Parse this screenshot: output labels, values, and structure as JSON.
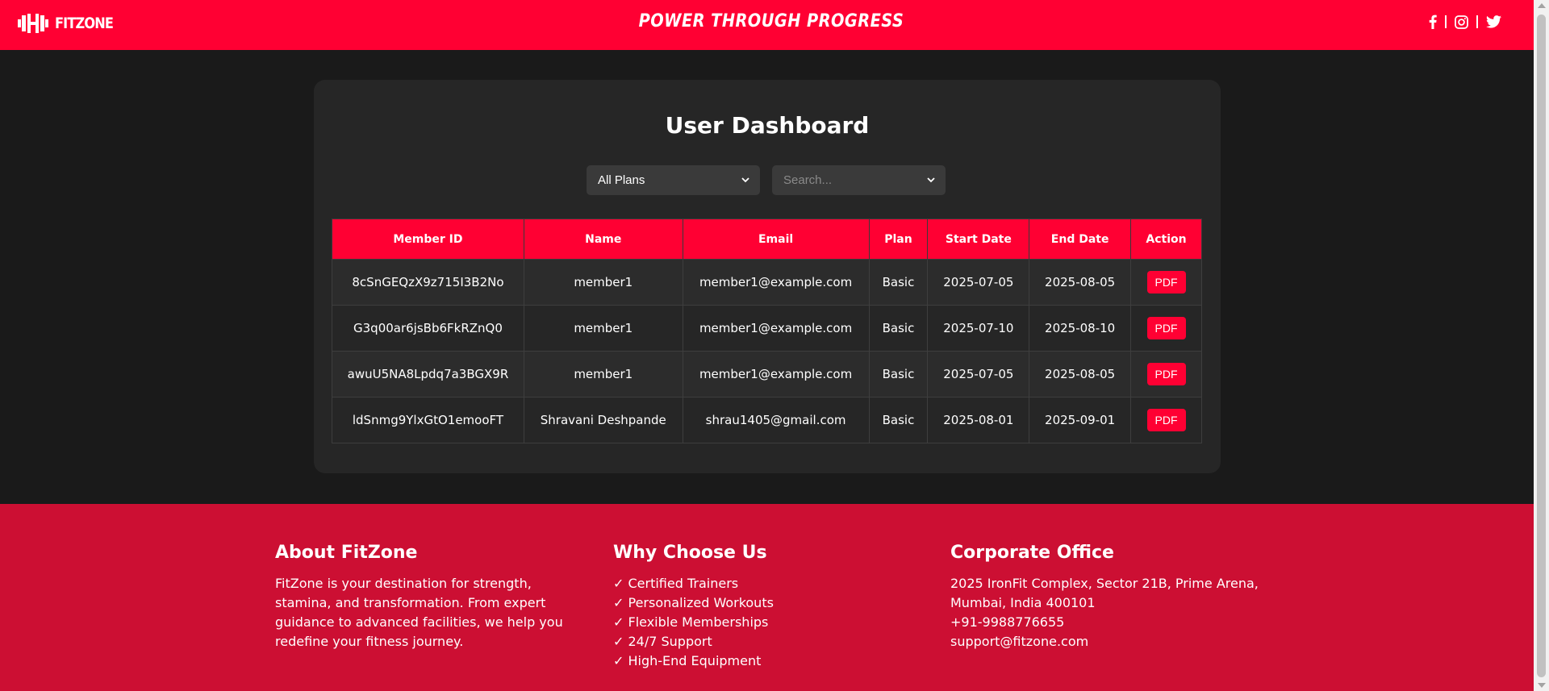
{
  "brand": {
    "name": "FITZONE",
    "slogan": "POWER THROUGH PROGRESS",
    "accent": "#ff0033"
  },
  "social": {
    "icons": [
      "facebook-icon",
      "instagram-icon",
      "twitter-icon"
    ]
  },
  "dashboard": {
    "title": "User Dashboard",
    "plan_filter": {
      "value": "All Plans"
    },
    "search": {
      "placeholder": "Search..."
    },
    "columns": [
      "Member ID",
      "Name",
      "Email",
      "Plan",
      "Start Date",
      "End Date",
      "Action"
    ],
    "rows": [
      {
        "id": "8cSnGEQzX9z715I3B2No",
        "name": "member1",
        "email": "member1@example.com",
        "plan": "Basic",
        "start": "2025-07-05",
        "end": "2025-08-05",
        "action": "PDF"
      },
      {
        "id": "G3q00ar6jsBb6FkRZnQ0",
        "name": "member1",
        "email": "member1@example.com",
        "plan": "Basic",
        "start": "2025-07-10",
        "end": "2025-08-10",
        "action": "PDF"
      },
      {
        "id": "awuU5NA8Lpdq7a3BGX9R",
        "name": "member1",
        "email": "member1@example.com",
        "plan": "Basic",
        "start": "2025-07-05",
        "end": "2025-08-05",
        "action": "PDF"
      },
      {
        "id": "ldSnmg9YlxGtO1emooFT",
        "name": "Shravani Deshpande",
        "email": "shrau1405@gmail.com",
        "plan": "Basic",
        "start": "2025-08-01",
        "end": "2025-09-01",
        "action": "PDF"
      }
    ]
  },
  "footer": {
    "about": {
      "title": "About FitZone",
      "text": "FitZone is your destination for strength, stamina, and transformation. From expert guidance to advanced facilities, we help you redefine your fitness journey."
    },
    "why": {
      "title": "Why Choose Us",
      "items": [
        "✓ Certified Trainers",
        "✓ Personalized Workouts",
        "✓ Flexible Memberships",
        "✓ 24/7 Support",
        "✓ High-End Equipment"
      ]
    },
    "office": {
      "title": "Corporate Office",
      "lines": [
        "2025 IronFit Complex, Sector 21B, Prime Arena,",
        "Mumbai, India 400101",
        "+91-9988776655",
        "support@fitzone.com"
      ]
    }
  }
}
